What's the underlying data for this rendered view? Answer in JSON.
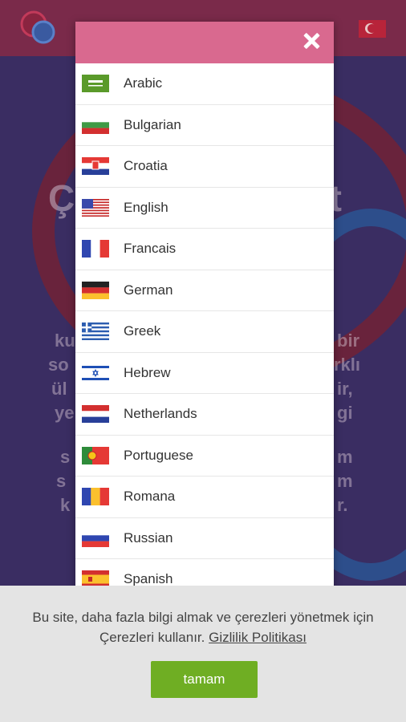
{
  "modal": {
    "languages": [
      {
        "label": "Arabic",
        "flag": "saudi-arabia-flag-icon"
      },
      {
        "label": "Bulgarian",
        "flag": "bulgaria-flag-icon"
      },
      {
        "label": "Croatia",
        "flag": "croatia-flag-icon"
      },
      {
        "label": "English",
        "flag": "usa-flag-icon"
      },
      {
        "label": "Francais",
        "flag": "france-flag-icon"
      },
      {
        "label": "German",
        "flag": "germany-flag-icon"
      },
      {
        "label": "Greek",
        "flag": "greece-flag-icon"
      },
      {
        "label": "Hebrew",
        "flag": "israel-flag-icon"
      },
      {
        "label": "Netherlands",
        "flag": "netherlands-flag-icon"
      },
      {
        "label": "Portuguese",
        "flag": "portugal-flag-icon"
      },
      {
        "label": "Romana",
        "flag": "romania-flag-icon"
      },
      {
        "label": "Russian",
        "flag": "russia-flag-icon"
      },
      {
        "label": "Spanish",
        "flag": "spain-flag-icon"
      }
    ],
    "close_icon": "close-icon",
    "header_color": "#d9698f"
  },
  "cookie": {
    "text": "Bu site, daha fazla bilgi almak ve çerezleri yönetmek için Çerezleri kullanır.",
    "link": "Gizlilik Politikası",
    "button": "tamam",
    "button_color": "#6fae23"
  },
  "background": {
    "title_left": "Ç",
    "title_right": "et",
    "lines_left": [
      "ku",
      "so",
      "ül",
      "ye",
      "s",
      "s",
      "k"
    ],
    "lines_right": [
      "bir",
      "rklı",
      "ir,",
      "gi",
      "m",
      "m",
      "r."
    ],
    "header_flag": "turkey-flag-icon"
  }
}
